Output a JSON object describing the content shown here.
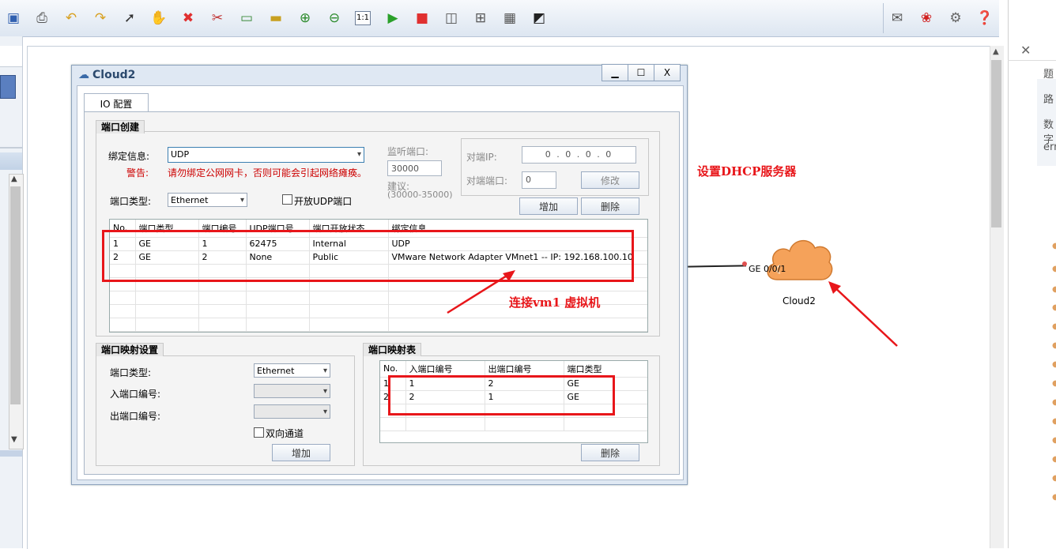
{
  "toolbar": {
    "icons": [
      "save-icon",
      "print-icon",
      "undo-icon",
      "redo-icon",
      "select-pointer-icon",
      "hand-pan-icon",
      "delete-icon",
      "delete-link-icon",
      "text-note-icon",
      "rectangle-icon",
      "zoom-in-icon",
      "zoom-out-icon",
      "fit-1to1-icon",
      "start-icon",
      "stop-icon",
      "capture-icon",
      "topology-icon",
      "grid-icon",
      "screenshot-icon"
    ],
    "right_icons": [
      "chat-icon",
      "huawei-logo-icon",
      "settings-icon",
      "help-icon"
    ]
  },
  "right_panel": {
    "texts": [
      "题",
      "路",
      "数字",
      "ern"
    ]
  },
  "dialog": {
    "title": "Cloud2",
    "min_label": "▁",
    "max_label": "☐",
    "close_label": "X",
    "tab_label": "IO 配置",
    "port_create": {
      "title": "端口创建",
      "bind_label": "绑定信息:",
      "bind_value": "UDP",
      "warn_label": "警告:",
      "warn_text": "请勿绑定公网网卡，否则可能会引起网络瘫痪。",
      "port_type_label": "端口类型:",
      "port_type_value": "Ethernet",
      "open_udp_label": "开放UDP端口",
      "listen_label": "监听端口:",
      "listen_value": "30000",
      "suggest_label": "建议:",
      "suggest_range": "(30000-35000)",
      "peer_ip_label": "对端IP:",
      "peer_ip_value": "0 . 0 . 0 . 0",
      "peer_port_label": "对端端口:",
      "peer_port_value": "0",
      "modify_label": "修改",
      "add_label": "增加",
      "delete_label": "删除",
      "table": {
        "headers": [
          "No.",
          "端口类型",
          "端口编号",
          "UDP端口号",
          "端口开放状态",
          "绑定信息"
        ],
        "rows": [
          [
            "1",
            "GE",
            "1",
            "62475",
            "Internal",
            "UDP"
          ],
          [
            "2",
            "GE",
            "2",
            "None",
            "Public",
            "VMware Network Adapter VMnet1 -- IP: 192.168.100.10"
          ]
        ]
      }
    },
    "port_map": {
      "title": "端口映射设置",
      "type_label": "端口类型:",
      "type_value": "Ethernet",
      "in_label": "入端口编号:",
      "out_label": "出端口编号:",
      "bidir_label": "双向通道",
      "add_label": "增加"
    },
    "map_table": {
      "title": "端口映射表",
      "headers": [
        "No.",
        "入端口编号",
        "出端口编号",
        "端口类型"
      ],
      "rows": [
        [
          "1",
          "1",
          "2",
          "GE"
        ],
        [
          "2",
          "2",
          "1",
          "GE"
        ]
      ],
      "delete_label": "删除"
    }
  },
  "canvas": {
    "cloud_label": "Cloud2",
    "port_label": "GE 0/0/1"
  },
  "annotations": {
    "dhcp_text": "设置DHCP服务器",
    "vm_text": "连接vm1  虚拟机"
  },
  "colors": {
    "annotation_red": "#e8161a",
    "cloud_orange": "#f5a25a",
    "warning_red": "#cc0000"
  }
}
